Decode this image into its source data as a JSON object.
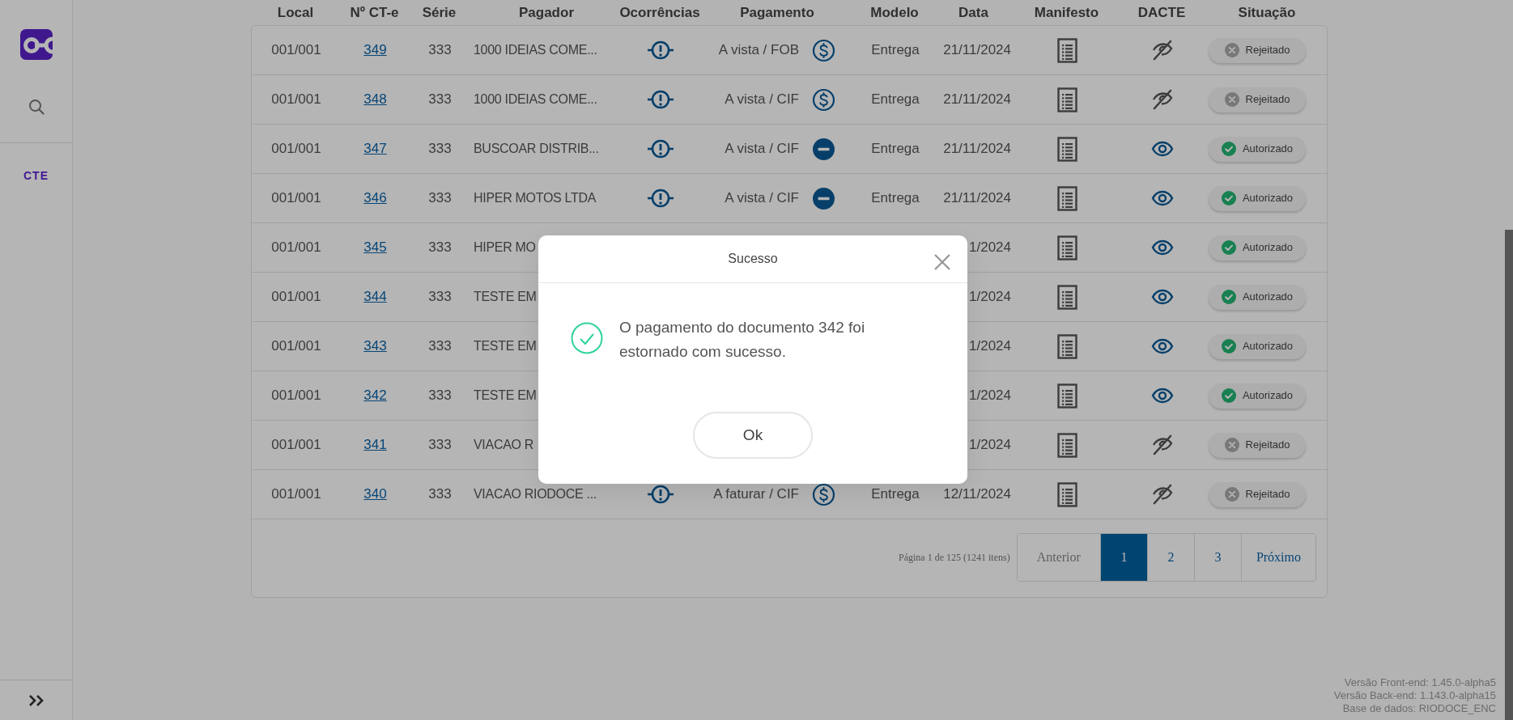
{
  "sidebar": {
    "section_label": "CTE"
  },
  "table": {
    "columns": [
      "Local",
      "Nº CT-e",
      "Série",
      "Pagador",
      "Ocorrências",
      "Pagamento",
      "Modelo",
      "Data",
      "Manifesto",
      "DACTE",
      "Situação"
    ],
    "rows": [
      {
        "local": "001/001",
        "number": "349",
        "serie": "333",
        "pagador": "1000 IDEIAS COME...",
        "occurrence": true,
        "payment": {
          "text": "A vista / FOB",
          "kind": "dollar"
        },
        "modelo": "Entrega",
        "data": "21/11/2024",
        "dacte_available": false,
        "status": {
          "kind": "rejected",
          "label": "Rejeitado"
        }
      },
      {
        "local": "001/001",
        "number": "348",
        "serie": "333",
        "pagador": "1000 IDEIAS COME...",
        "occurrence": true,
        "payment": {
          "text": "A vista / CIF",
          "kind": "dollar"
        },
        "modelo": "Entrega",
        "data": "21/11/2024",
        "dacte_available": false,
        "status": {
          "kind": "rejected",
          "label": "Rejeitado"
        }
      },
      {
        "local": "001/001",
        "number": "347",
        "serie": "333",
        "pagador": "BUSCOAR DISTRIB...",
        "occurrence": true,
        "payment": {
          "text": "A vista / CIF",
          "kind": "minus"
        },
        "modelo": "Entrega",
        "data": "21/11/2024",
        "dacte_available": true,
        "status": {
          "kind": "authorized",
          "label": "Autorizado"
        }
      },
      {
        "local": "001/001",
        "number": "346",
        "serie": "333",
        "pagador": "HIPER MOTOS LTDA",
        "occurrence": true,
        "payment": {
          "text": "A vista / CIF",
          "kind": "minus"
        },
        "modelo": "Entrega",
        "data": "21/11/2024",
        "dacte_available": true,
        "status": {
          "kind": "authorized",
          "label": "Autorizado"
        }
      },
      {
        "local": "001/001",
        "number": "345",
        "serie": "333",
        "pagador": "HIPER MO",
        "data": "1/2024",
        "dacte_available": true,
        "status": {
          "kind": "authorized",
          "label": "Autorizado"
        }
      },
      {
        "local": "001/001",
        "number": "344",
        "serie": "333",
        "pagador": "TESTE EM",
        "data": "1/2024",
        "dacte_available": true,
        "status": {
          "kind": "authorized",
          "label": "Autorizado"
        }
      },
      {
        "local": "001/001",
        "number": "343",
        "serie": "333",
        "pagador": "TESTE EM",
        "data": "1/2024",
        "dacte_available": true,
        "status": {
          "kind": "authorized",
          "label": "Autorizado"
        }
      },
      {
        "local": "001/001",
        "number": "342",
        "serie": "333",
        "pagador": "TESTE EM",
        "data": "1/2024",
        "dacte_available": true,
        "status": {
          "kind": "authorized",
          "label": "Autorizado"
        }
      },
      {
        "local": "001/001",
        "number": "341",
        "serie": "333",
        "pagador": "VIACAO R",
        "data": "1/2024",
        "dacte_available": false,
        "status": {
          "kind": "rejected",
          "label": "Rejeitado"
        }
      },
      {
        "local": "001/001",
        "number": "340",
        "serie": "333",
        "pagador": "VIACAO RIODOCE ...",
        "occurrence": true,
        "payment": {
          "text": "A faturar / CIF",
          "kind": "dollar"
        },
        "modelo": "Entrega",
        "data": "12/11/2024",
        "dacte_available": false,
        "status": {
          "kind": "rejected",
          "label": "Rejeitado"
        }
      }
    ]
  },
  "pagination": {
    "summary": "Página 1 de 125 (1241 itens)",
    "buttons": [
      {
        "label": "Anterior",
        "selected": false
      },
      {
        "label": "1",
        "selected": true
      },
      {
        "label": "2",
        "selected": false
      },
      {
        "label": "3",
        "selected": false
      },
      {
        "label": "Próximo",
        "selected": false
      }
    ]
  },
  "version_info": [
    "Versão Front-end: 1.45.0-alpha5",
    "Versão Back-end: 1.143.0-alpha15",
    "Base de dados: RIODOCE_ENC"
  ],
  "dialog": {
    "title": "Sucesso",
    "message": "O pagamento do documento 342 foi estornado com sucesso.",
    "button": "Ok"
  }
}
